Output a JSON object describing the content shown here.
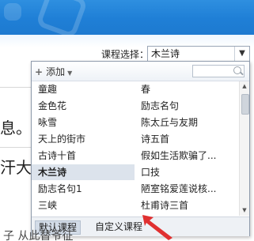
{
  "header": {
    "course_label": "课程选择：",
    "course_value": "木兰诗"
  },
  "document_fragments": {
    "line1": "息。",
    "line2": "汗大",
    "bottom": "子  从此替爷征"
  },
  "dropdown": {
    "add_label": "添加",
    "search_placeholder": "",
    "rows": [
      {
        "left": "童趣",
        "right": "春"
      },
      {
        "left": "金色花",
        "right": "励志名句"
      },
      {
        "left": "咏雪",
        "right": "陈太丘与友期"
      },
      {
        "left": "天上的街市",
        "right": "诗五首"
      },
      {
        "left": "古诗十首",
        "right": "假如生活欺骗了..."
      },
      {
        "left": "木兰诗",
        "right": "口技"
      },
      {
        "left": "励志名句1",
        "right": "陋室铭爱莲说核..."
      },
      {
        "left": "三峡",
        "right": "杜甫诗三首"
      }
    ],
    "selected_index": 5,
    "tabs": [
      "默认课程",
      "自定义课程"
    ],
    "active_tab": 0
  },
  "colors": {
    "header_blue": "#1f7fd6",
    "arrow_red": "#e03030"
  },
  "icons": [
    "plus-icon",
    "caret-down-icon",
    "search-icon",
    "dropdown-arrow-icon",
    "scroll-up-icon",
    "scroll-down-icon",
    "red-arrow-icon"
  ]
}
